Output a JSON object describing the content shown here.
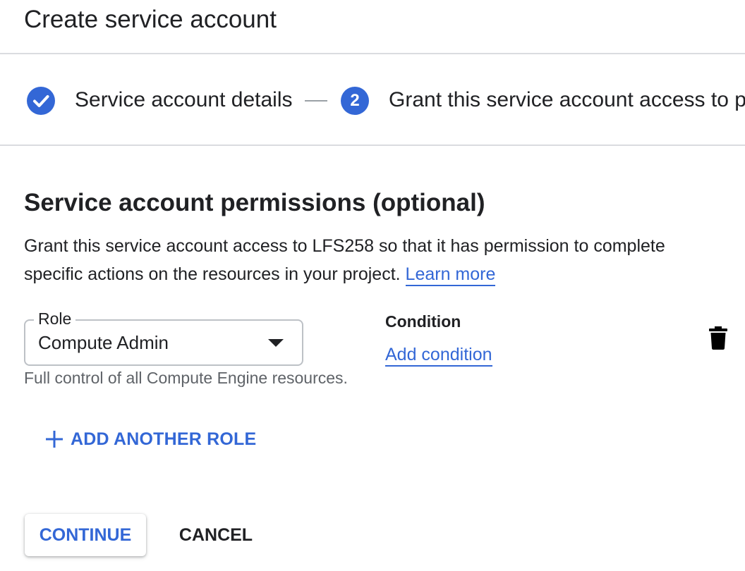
{
  "header": {
    "title": "Create service account"
  },
  "stepper": {
    "steps": [
      {
        "label": "Service account details",
        "state": "completed",
        "icon": "check-icon"
      },
      {
        "label": "Grant this service account access to p",
        "state": "current",
        "number": "2"
      }
    ]
  },
  "permissions": {
    "title": "Service account permissions (optional)",
    "description": "Grant this service account access to LFS258 so that it has permission to complete specific actions on the resources in your project.",
    "learn_more": "Learn more"
  },
  "role": {
    "label": "Role",
    "value": "Compute Admin",
    "hint": "Full control of all Compute Engine resources."
  },
  "condition": {
    "label": "Condition",
    "add_link": "Add condition"
  },
  "actions": {
    "add_role": "ADD ANOTHER ROLE",
    "continue": "CONTINUE",
    "cancel": "CANCEL"
  },
  "colors": {
    "accent": "#3367d6",
    "text": "#202124",
    "muted": "#5f6368",
    "divider": "#dadce0"
  }
}
